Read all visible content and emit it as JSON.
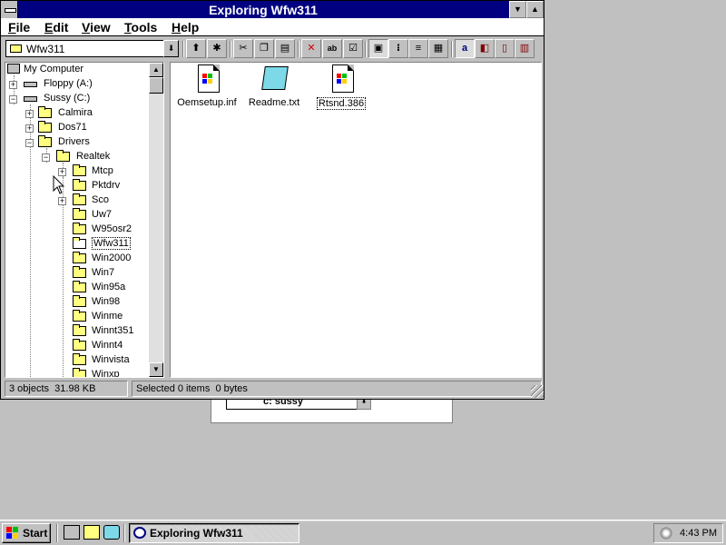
{
  "window": {
    "title": "Exploring Wfw311",
    "minimize_glyph": "▼",
    "maximize_glyph": "▲"
  },
  "menubar": {
    "items": [
      "File",
      "Edit",
      "View",
      "Tools",
      "Help"
    ]
  },
  "toolbar": {
    "address_value": "Wfw311",
    "address_drop_glyph": "⬇",
    "buttons": [
      {
        "name": "up-one-level",
        "icon": "folder-up-icon",
        "glyph": "⬆"
      },
      {
        "name": "map-network-drive",
        "icon": "map-drive-icon",
        "glyph": "✱"
      },
      {
        "name": "cut",
        "icon": "scissors-icon",
        "glyph": "✂"
      },
      {
        "name": "copy",
        "icon": "copy-icon",
        "glyph": "❐"
      },
      {
        "name": "paste",
        "icon": "clipboard-icon",
        "glyph": "▤"
      },
      {
        "name": "delete",
        "icon": "x-icon",
        "glyph": "✕"
      },
      {
        "name": "rename",
        "icon": "rename-icon",
        "glyph": "ab"
      },
      {
        "name": "properties",
        "icon": "properties-icon",
        "glyph": "☑"
      },
      {
        "name": "large-icons",
        "icon": "large-icons-icon",
        "glyph": "▣"
      },
      {
        "name": "small-icons",
        "icon": "small-icons-icon",
        "glyph": "⁝"
      },
      {
        "name": "list-view",
        "icon": "list-icon",
        "glyph": "≡"
      },
      {
        "name": "details-view",
        "icon": "details-icon",
        "glyph": "▦"
      },
      {
        "name": "sort-by-name",
        "icon": "sort-name-icon",
        "glyph": "a"
      },
      {
        "name": "sort-by-type",
        "icon": "sort-type-icon",
        "glyph": "◧"
      },
      {
        "name": "sort-by-size",
        "icon": "sort-size-icon",
        "glyph": "▯"
      },
      {
        "name": "sort-by-date",
        "icon": "sort-date-icon",
        "glyph": "▥"
      }
    ]
  },
  "tree": {
    "items": [
      {
        "label": "My Computer",
        "type": "computer"
      },
      {
        "label": "Floppy (A:)",
        "type": "drive",
        "expander": "+"
      },
      {
        "label": "Sussy (C:)",
        "type": "drive",
        "expander": "−"
      },
      {
        "label": "Calmira",
        "type": "folder",
        "expander": "+"
      },
      {
        "label": "Dos71",
        "type": "folder",
        "expander": "+"
      },
      {
        "label": "Drivers",
        "type": "folder",
        "expander": "−"
      },
      {
        "label": "Realtek",
        "type": "folder",
        "expander": "−"
      },
      {
        "label": "Mtcp",
        "type": "folder",
        "expander": "+"
      },
      {
        "label": "Pktdrv",
        "type": "folder"
      },
      {
        "label": "Sco",
        "type": "folder",
        "expander": "+"
      },
      {
        "label": "Uw7",
        "type": "folder"
      },
      {
        "label": "W95osr2",
        "type": "folder"
      },
      {
        "label": "Wfw311",
        "type": "folder-open"
      },
      {
        "label": "Win2000",
        "type": "folder"
      },
      {
        "label": "Win7",
        "type": "folder"
      },
      {
        "label": "Win95a",
        "type": "folder"
      },
      {
        "label": "Win98",
        "type": "folder"
      },
      {
        "label": "Winme",
        "type": "folder"
      },
      {
        "label": "Winnt351",
        "type": "folder"
      },
      {
        "label": "Winnt4",
        "type": "folder"
      },
      {
        "label": "Winvista",
        "type": "folder"
      },
      {
        "label": "Winxp",
        "type": "folder"
      }
    ],
    "scroll_up_glyph": "▲",
    "scroll_down_glyph": "▼"
  },
  "files": [
    {
      "name": "Oemsetup.inf",
      "icon": "setup-file-icon"
    },
    {
      "name": "Readme.txt",
      "icon": "notepad-icon"
    },
    {
      "name": "Rtsnd.386",
      "icon": "system-file-icon"
    }
  ],
  "statusbar": {
    "objects": "3 objects",
    "size": "31.98 KB",
    "selected": "Selected 0 items",
    "selected_size": "0 bytes"
  },
  "background_dialog": {
    "combo_value": "c: sussy",
    "drop_glyph": "⬇"
  },
  "taskbar": {
    "start_label": "Start",
    "task_label": "Exploring Wfw311",
    "clock": "4:43 PM"
  },
  "colors": {
    "titlebar": "#000080",
    "desktop": "#c0c0c0",
    "folder": "#ffff80"
  }
}
